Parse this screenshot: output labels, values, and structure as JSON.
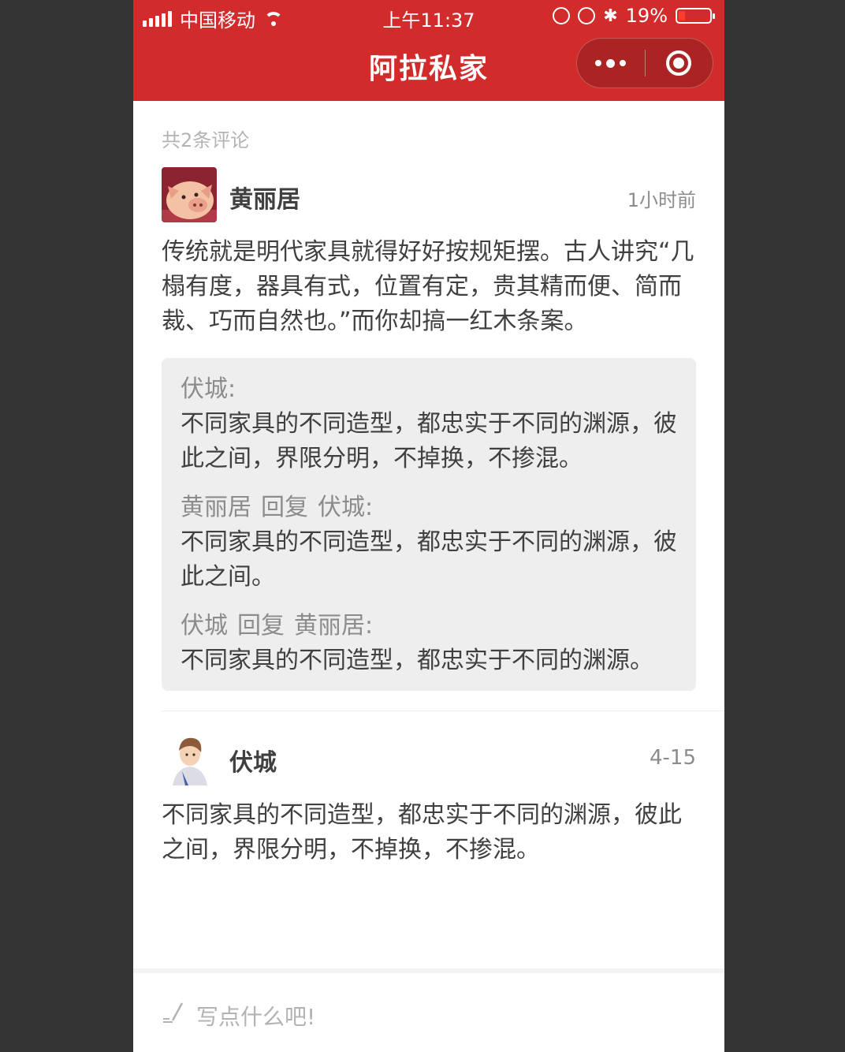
{
  "status_bar": {
    "carrier": "中国移动",
    "time": "上午11:37",
    "battery": "19%"
  },
  "header": {
    "title": "阿拉私家"
  },
  "comment_count": "共2条评论",
  "comments": [
    {
      "user": "黄丽居",
      "time": "1小时前",
      "text": "传统就是明代家具就得好好按规矩摆。古人讲究“几榻有度，器具有式，位置有定，贵其精而便、简而裁、巧而自然也。”而你却搞一红木条案。",
      "replies": [
        {
          "from": "伏城:",
          "reply_word": "",
          "to": "",
          "text": "不同家具的不同造型，都忠实于不同的渊源，彼此之间，界限分明，不掉换，不掺混。"
        },
        {
          "from": "黄丽居",
          "reply_word": "回复",
          "to": "伏城:",
          "text": "不同家具的不同造型，都忠实于不同的渊源，彼此之间。"
        },
        {
          "from": "伏城",
          "reply_word": "回复",
          "to": "黄丽居:",
          "text": "不同家具的不同造型，都忠实于不同的渊源。"
        }
      ]
    },
    {
      "user": "伏城",
      "time": "4-15",
      "text": "不同家具的不同造型，都忠实于不同的渊源，彼此之间，界限分明，不掉换，不掺混。"
    }
  ],
  "input": {
    "placeholder": "写点什么吧!"
  },
  "colors": {
    "brand": "#d12b2b",
    "text": "#404040",
    "secondary": "#8c8c8c",
    "count": "#b3b3b3",
    "reply_bg": "#eeeeee"
  }
}
